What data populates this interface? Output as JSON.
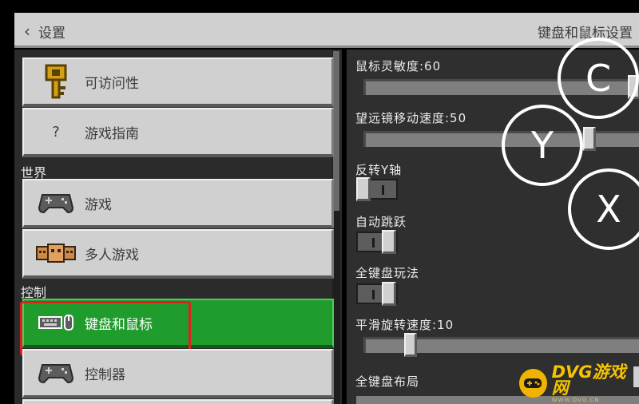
{
  "header": {
    "back_label": "设置",
    "title": "键盘和鼠标设置"
  },
  "sidebar": {
    "items": [
      {
        "label": "可访问性",
        "icon": "key-icon"
      },
      {
        "label": "游戏指南",
        "icon": "question-icon",
        "glyph": "?"
      },
      {
        "label": "游戏",
        "icon": "gamepad-icon"
      },
      {
        "label": "多人游戏",
        "icon": "players-icon"
      },
      {
        "label": "键盘和鼠标",
        "icon": "keyboard-mouse-icon",
        "selected": true
      },
      {
        "label": "控制器",
        "icon": "gamepad-icon"
      }
    ],
    "sections": {
      "world": "世界",
      "controls": "控制"
    }
  },
  "settings": {
    "mouse_sensitivity": {
      "label": "鼠标灵敏度:60",
      "value": 60
    },
    "spyglass_speed": {
      "label": "望远镜移动速度:50",
      "value": 50
    },
    "invert_y": {
      "label": "反转Y轴",
      "on": false
    },
    "auto_jump": {
      "label": "自动跳跃",
      "on": true
    },
    "full_keyboard": {
      "label": "全键盘玩法",
      "on": true
    },
    "smooth_rotation": {
      "label": "平滑旋转速度:10",
      "value": 10
    },
    "keyboard_layout": {
      "label": "全键盘布局"
    }
  },
  "overlay_buttons": {
    "c": "C",
    "y": "Y",
    "x": "X"
  },
  "watermark": {
    "text": "DVG游戏网",
    "url": "WWW.DVG.CN"
  },
  "colors": {
    "accent": "#1f9c2c",
    "highlight": "#e02020",
    "panel": "#d0d0d0",
    "watermark": "#f0b400"
  }
}
